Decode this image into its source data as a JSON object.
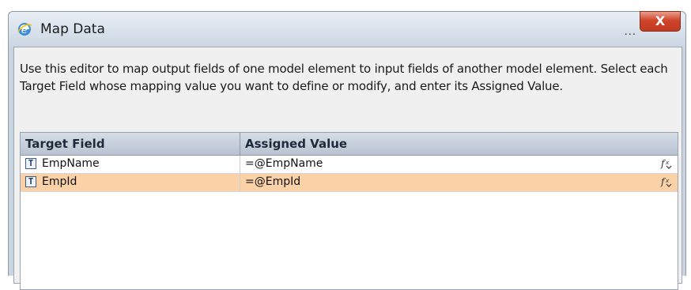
{
  "window": {
    "title": "Map Data",
    "overflow_glyph": "...",
    "close_glyph": "X"
  },
  "description": "Use this editor to map output fields of one model element to input fields of another model element. Select each Target Field whose mapping value you want to define or modify, and enter its Assigned Value.",
  "grid": {
    "columns": [
      "Target Field",
      "Assigned Value"
    ],
    "rows": [
      {
        "type_icon": "T",
        "field": "EmpName",
        "value": "=@EmpName",
        "fx": "fx"
      },
      {
        "type_icon": "T",
        "field": "EmpId",
        "value": "=@EmpId",
        "fx": "fx"
      }
    ],
    "selected_row_color": "#fbd2a8"
  },
  "icons": {
    "app": "internet-explorer-icon",
    "field_type": "text-type-icon",
    "expression": "function-expression-icon"
  }
}
